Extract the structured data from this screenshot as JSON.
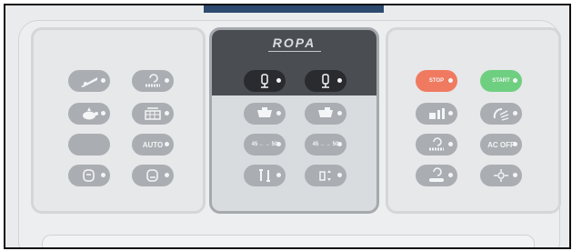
{
  "brand": {
    "name": "ROPA"
  },
  "colors": {
    "dark_button": "#2a2b2e",
    "grey_button": "#aaadb1",
    "stop_red": "#f07a60",
    "start_green": "#6fcf80",
    "header_dark": "#4a4d52"
  },
  "left_panel": {
    "buttons": [
      {
        "icon": "ramp-slope-icon"
      },
      {
        "icon": "rotation-chain-icon"
      },
      {
        "icon": "turtle-slow-icon"
      },
      {
        "icon": "conveyor-grid-icon"
      },
      {
        "icon": "blank-button"
      },
      {
        "icon": "auto-icon",
        "label": "AUTO"
      },
      {
        "icon": "cleaner-drum-icon"
      },
      {
        "icon": "cleaner-drum-right-icon"
      }
    ]
  },
  "center_panel": {
    "buttons": [
      {
        "icon": "joystick-left-icon"
      },
      {
        "icon": "joystick-right-icon"
      },
      {
        "icon": "hopper-icon"
      },
      {
        "icon": "hopper-right-icon"
      },
      {
        "icon": "chain-speed-icon",
        "label": "45 ←→ 50"
      },
      {
        "icon": "wheel-speed-icon",
        "label": "45 ←→ 50"
      },
      {
        "icon": "tools-icon"
      },
      {
        "icon": "level-adjust-icon"
      }
    ]
  },
  "right_panel": {
    "buttons": [
      {
        "icon": "engine-stop-icon",
        "label": "STOP"
      },
      {
        "icon": "engine-start-icon",
        "label": "START"
      },
      {
        "icon": "gear-level-icon"
      },
      {
        "icon": "work-light-icon"
      },
      {
        "icon": "rotation-chain-icon"
      },
      {
        "icon": "ac-off-snowflake-icon",
        "label": "AC OFF"
      },
      {
        "icon": "rotation-belt-icon"
      },
      {
        "icon": "fan-heater-icon"
      }
    ]
  }
}
